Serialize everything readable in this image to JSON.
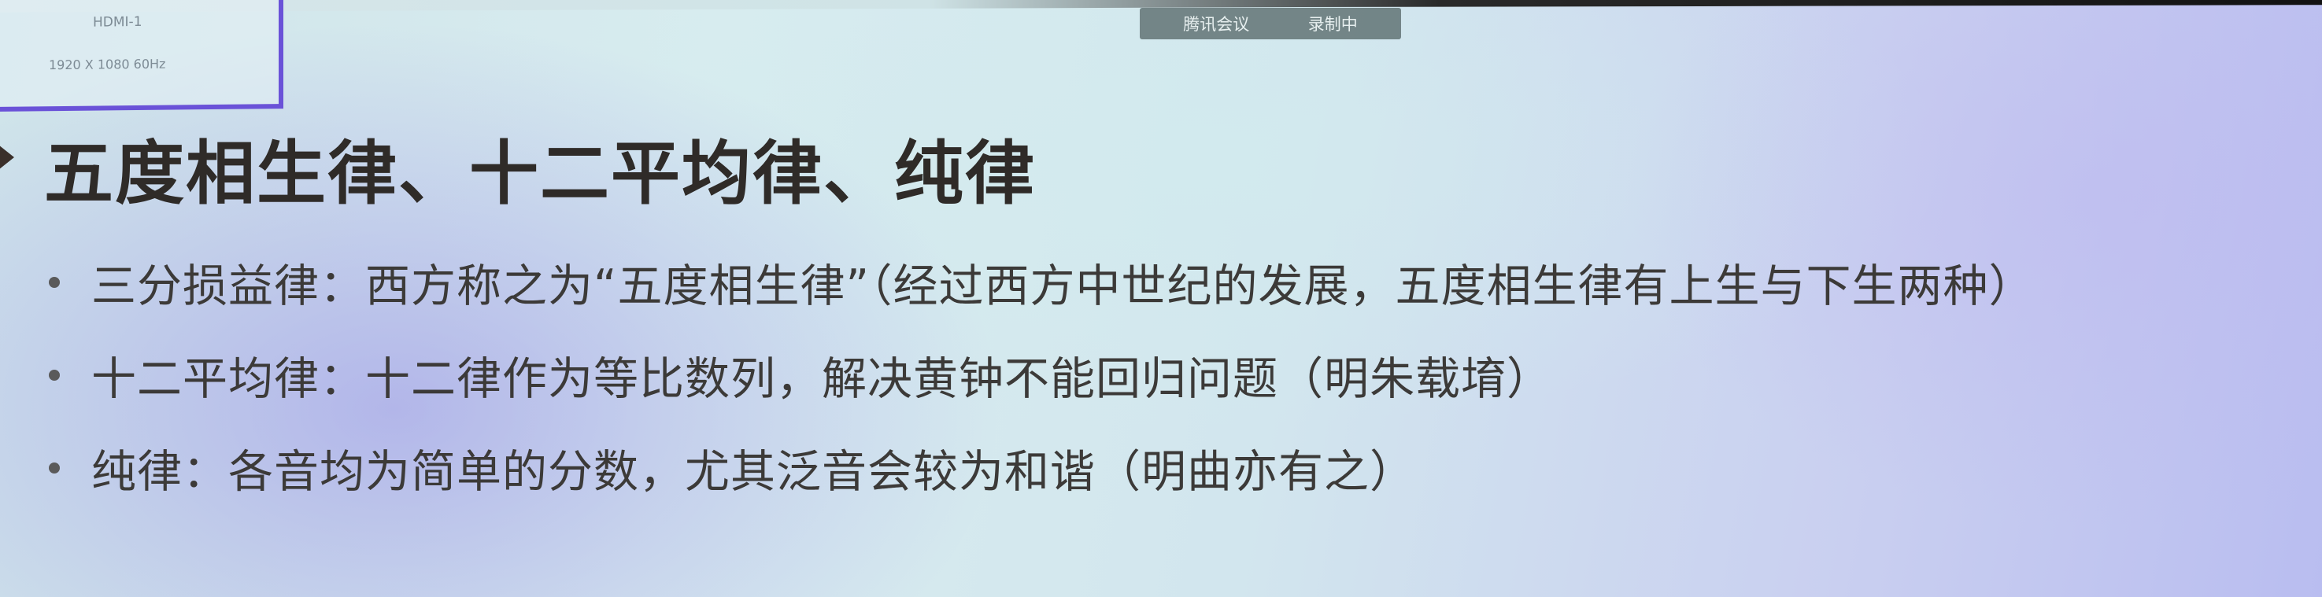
{
  "display_info": {
    "name": "HDMI-1",
    "resolution": "1920 X 1080 60Hz"
  },
  "meeting_bar": {
    "app": "腾讯会议",
    "status": "录制中"
  },
  "slide": {
    "title": "五度相生律、十二平均律、纯律",
    "bullets": [
      "三分损益律：西方称之为“五度相生律”（经过西方中世纪的发展，五度相生律有上生与下生两种）",
      "十二平均律：十二律作为等比数列，解决黄钟不能回归问题（明朱载堉）",
      "纯律：各音均为简单的分数，尤其泛音会较为和谐（明曲亦有之）"
    ]
  }
}
